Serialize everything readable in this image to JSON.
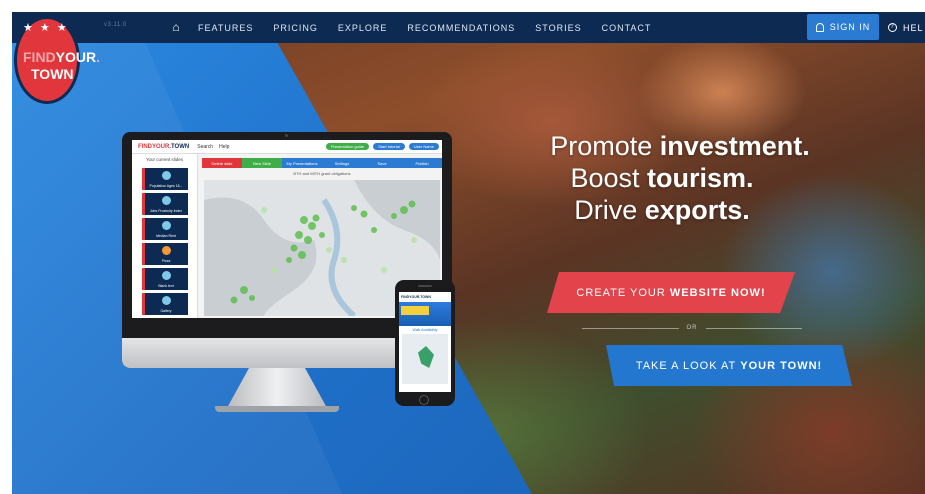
{
  "nav": {
    "version": "v3.11.0",
    "home_icon": "home-icon",
    "links": [
      "FEATURES",
      "PRICING",
      "EXPLORE",
      "RECOMMENDATIONS",
      "STORIES",
      "CONTACT"
    ],
    "signin_label": "SIGN IN",
    "signin_icon": "user-icon",
    "help_label": "HEL",
    "help_icon": "question-icon",
    "bg_color": "#0d2a52",
    "signin_color": "#2b7bd3"
  },
  "logo": {
    "line1_a": "FIND",
    "line1_b": "YOUR",
    "line1_dot": ".",
    "line2": "TOWN",
    "stars": "★ ★ ★",
    "color": "#e1373c"
  },
  "hero": {
    "l1_light": "Promote ",
    "l1_bold": "investment.",
    "l2_light": "Boost ",
    "l2_bold": "tourism.",
    "l3_light": "Drive ",
    "l3_bold": "exports."
  },
  "cta": {
    "primary_light": "CREATE YOUR ",
    "primary_bold": "WEBSITE NOW!",
    "primary_color": "#e3434a",
    "or": "OR",
    "secondary_light": "TAKE A LOOK AT ",
    "secondary_bold": "YOUR TOWN!",
    "secondary_color": "#2377cf"
  },
  "mockup": {
    "app_logo_a": "FINDYOUR.",
    "app_logo_b": "TOWN",
    "menu": [
      "Search",
      "Help"
    ],
    "pills": [
      {
        "label": "Presentation guide",
        "color": "#3fae49"
      },
      {
        "label": "Start tutorial",
        "color": "#2b7bd3"
      },
      {
        "label": "User Name",
        "color": "#2b7bd3"
      }
    ],
    "sidebar_title": "Your current slides",
    "slides": [
      "Population Ages 18...",
      "Jobs Proximity Index",
      "Median Rent",
      "Pizza",
      "Blank text",
      "Gallery"
    ],
    "tabs": [
      {
        "label": "Delete slide",
        "color": "#e1373c"
      },
      {
        "label": "New Slide",
        "color": "#3fae49"
      },
      {
        "label": "My Presentations",
        "color": "#2b7bd3"
      },
      {
        "label": "Settings",
        "color": "#2b7bd3"
      },
      {
        "label": "Save",
        "color": "#2b7bd3"
      },
      {
        "label": "Publish",
        "color": "#2b7bd3"
      }
    ],
    "map_title": "BTH and MITH grant obligations",
    "phone_title": "FINDYOUR.TOWN",
    "phone_label": "Walk Availability"
  }
}
